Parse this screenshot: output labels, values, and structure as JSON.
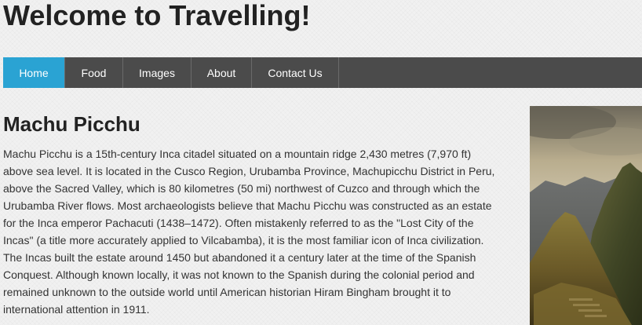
{
  "header": {
    "title": "Welcome to Travelling!"
  },
  "nav": {
    "items": [
      {
        "label": "Home",
        "active": true
      },
      {
        "label": "Food",
        "active": false
      },
      {
        "label": "Images",
        "active": false
      },
      {
        "label": "About",
        "active": false
      },
      {
        "label": "Contact Us",
        "active": false
      }
    ]
  },
  "main": {
    "title": "Machu Picchu",
    "paragraph": "Machu Picchu is a 15th-century Inca citadel situated on a mountain ridge 2,430 metres (7,970 ft) above sea level. It is located in the Cusco Region, Urubamba Province, Machupicchu District in Peru, above the Sacred Valley, which is 80 kilometres (50 mi) northwest of Cuzco and through which the Urubamba River flows. Most archaeologists believe that Machu Picchu was constructed as an estate for the Inca emperor Pachacuti (1438–1472). Often mistakenly referred to as the \"Lost City of the Incas\" (a title more accurately applied to Vilcabamba), it is the most familiar icon of Inca civilization. The Incas built the estate around 1450 but abandoned it a century later at the time of the Spanish Conquest. Although known locally, it was not known to the Spanish during the colonial period and remained unknown to the outside world until American historian Hiram Bingham brought it to international attention in 1911."
  },
  "colors": {
    "nav_background": "#4b4b4b",
    "nav_active": "#2aa3d3",
    "nav_text": "#ffffff",
    "page_background": "#f1f1f1",
    "text": "#222222"
  }
}
